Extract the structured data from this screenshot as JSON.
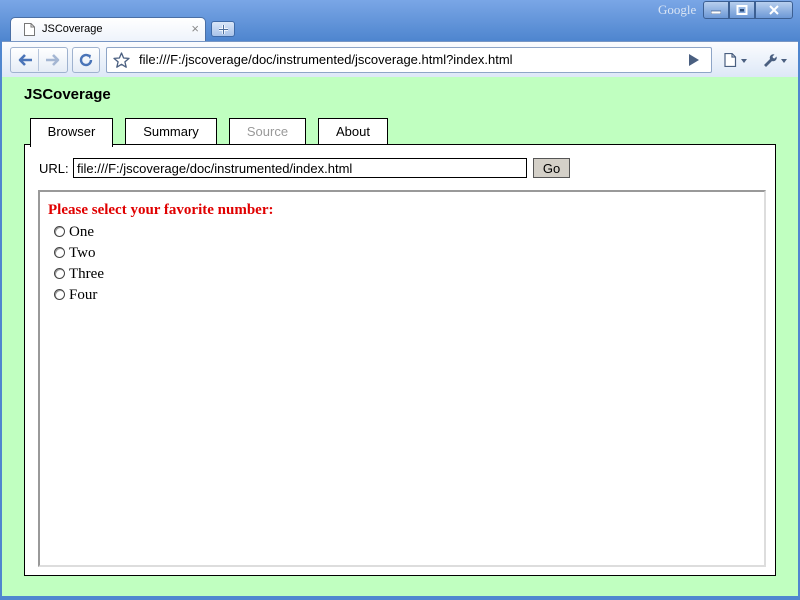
{
  "browser": {
    "tab_title": "JSCoverage",
    "brand": "Google",
    "address": "file:///F:/jscoverage/doc/instrumented/jscoverage.html?index.html"
  },
  "app": {
    "title": "JSCoverage",
    "tabs": [
      {
        "label": "Browser",
        "state": "active"
      },
      {
        "label": "Summary",
        "state": "normal"
      },
      {
        "label": "Source",
        "state": "disabled"
      },
      {
        "label": "About",
        "state": "normal"
      }
    ],
    "url_label": "URL:",
    "url_value": "file:///F:/jscoverage/doc/instrumented/index.html",
    "go_label": "Go"
  },
  "frame_page": {
    "question": "Please select your favorite number:",
    "options": [
      "One",
      "Two",
      "Three",
      "Four"
    ]
  },
  "colors": {
    "page_background": "#c0ffc0",
    "question_text": "#e00000"
  }
}
